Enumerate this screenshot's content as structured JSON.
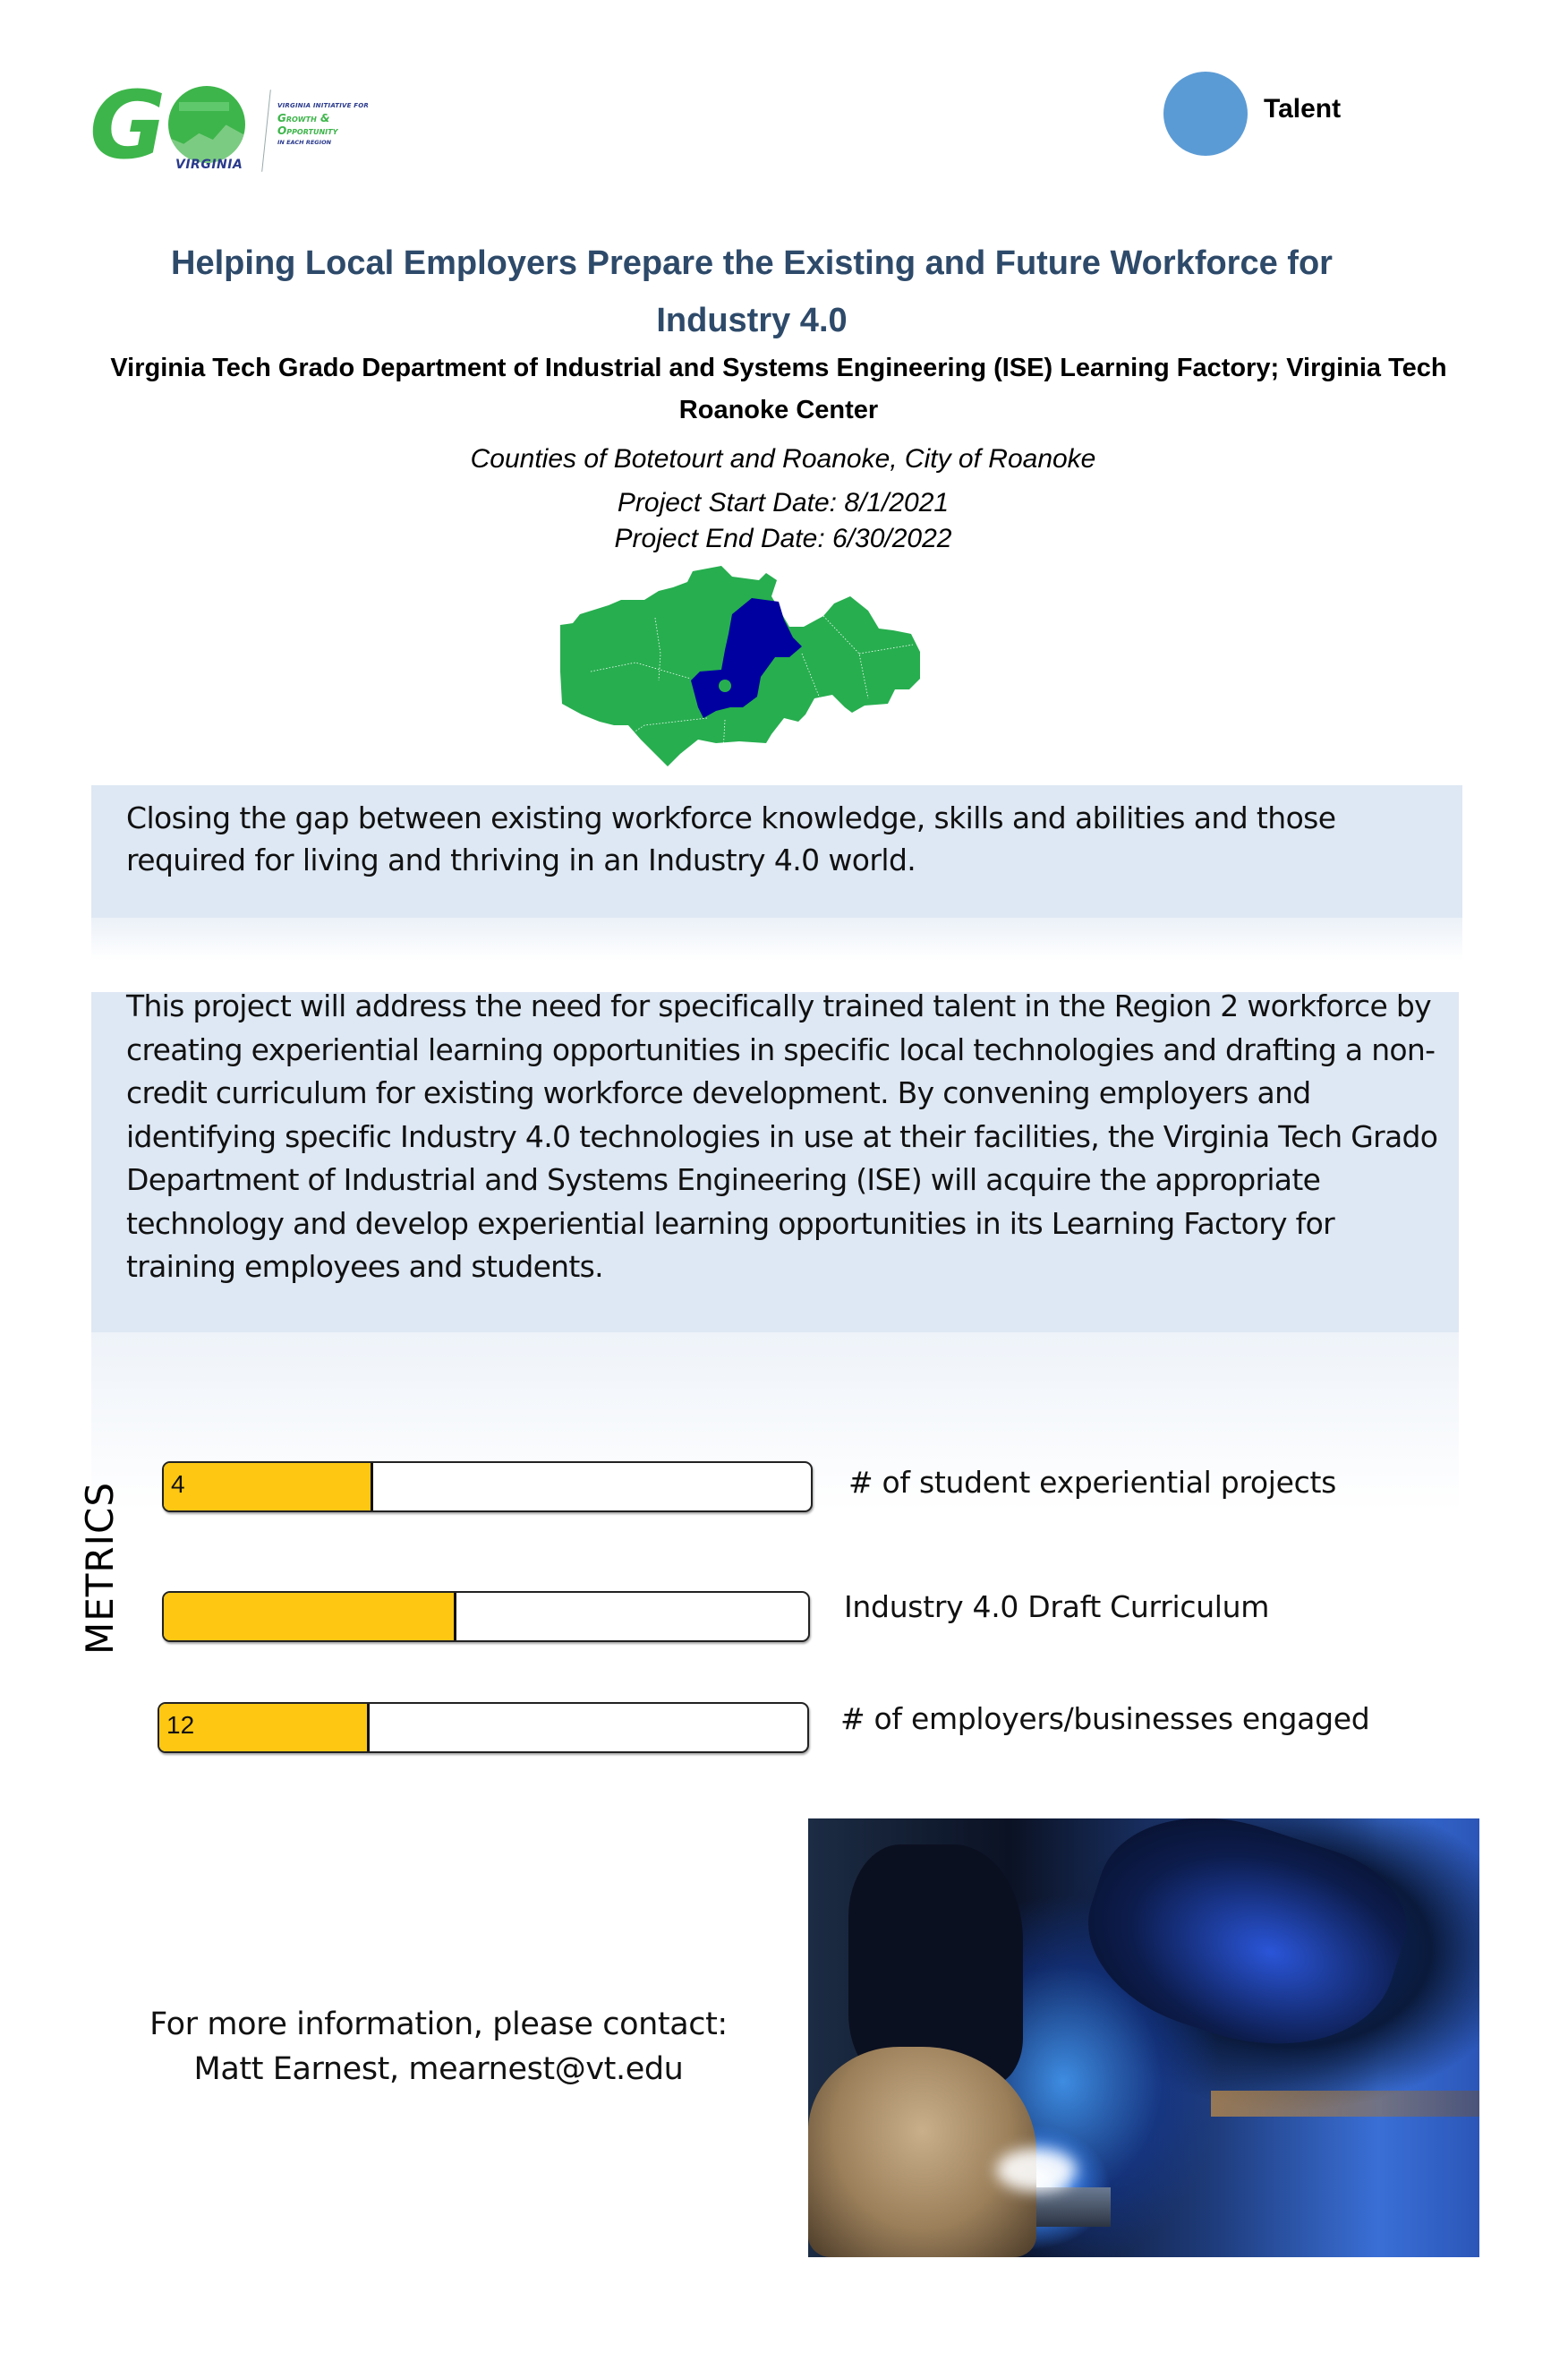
{
  "logo": {
    "letter_g": "G",
    "wordmark": "VIRGINIA",
    "tagline_top": "VIRGINIA INITIATIVE FOR",
    "tagline_main_1": "Growth &",
    "tagline_main_2": "Opportunity",
    "tagline_bottom": "IN EACH REGION",
    "colors": {
      "green": "#3DB54A",
      "navy": "#2A3A8C"
    }
  },
  "category_badge": {
    "label": "Talent",
    "color": "#5B9BD5"
  },
  "header": {
    "title": "Helping Local Employers Prepare the Existing and Future Workforce for Industry 4.0",
    "organization": "Virginia Tech Grado Department of Industrial and Systems Engineering (ISE) Learning Factory; Virginia Tech Roanoke Center",
    "locality": "Counties of Botetourt and Roanoke, City of Roanoke",
    "start_date": "Project Start Date: 8/1/2021",
    "end_date": "Project End Date: 6/30/2022",
    "title_color": "#2E4A6A"
  },
  "map": {
    "description": "Region 2 map with project localities highlighted",
    "region_color": "#27AE4F",
    "highlight_color": "#0000A0",
    "highlighted": [
      "Botetourt County",
      "Roanoke County",
      "City of Roanoke"
    ]
  },
  "summary": {
    "headline": "Closing the gap between existing workforce knowledge, skills and abilities and those required for living and thriving in an Industry 4.0 world.",
    "description": "This project will address the need for specifically trained talent in the Region 2 workforce by creating experiential learning opportunities in specific local technologies and drafting a non-credit curriculum for existing workforce development. By convening employers and identifying specific Industry 4.0 technologies in use at their facilities, the Virginia Tech Grado Department of Industrial and Systems Engineering (ISE) will acquire the appropriate technology and develop experiential learning opportunities in its Learning Factory for training employees and students.",
    "box_color": "#DEE8F4"
  },
  "metrics": {
    "section_label": "METRICS",
    "fill_color": "#FDC712",
    "items": [
      {
        "label": "# of student experiential projects",
        "value": "4",
        "progress": 0.32
      },
      {
        "label": "Industry 4.0 Draft Curriculum",
        "value": "",
        "progress": 0.45
      },
      {
        "label": "# of employers/businesses engaged",
        "value": "12",
        "progress": 0.32
      }
    ]
  },
  "contact": {
    "line1": "For more information, please contact:",
    "line2": "Matt Earnest, mearnest@vt.edu"
  },
  "photo": {
    "description": "Welder with helmet and glove welding metal, blue sparks"
  }
}
